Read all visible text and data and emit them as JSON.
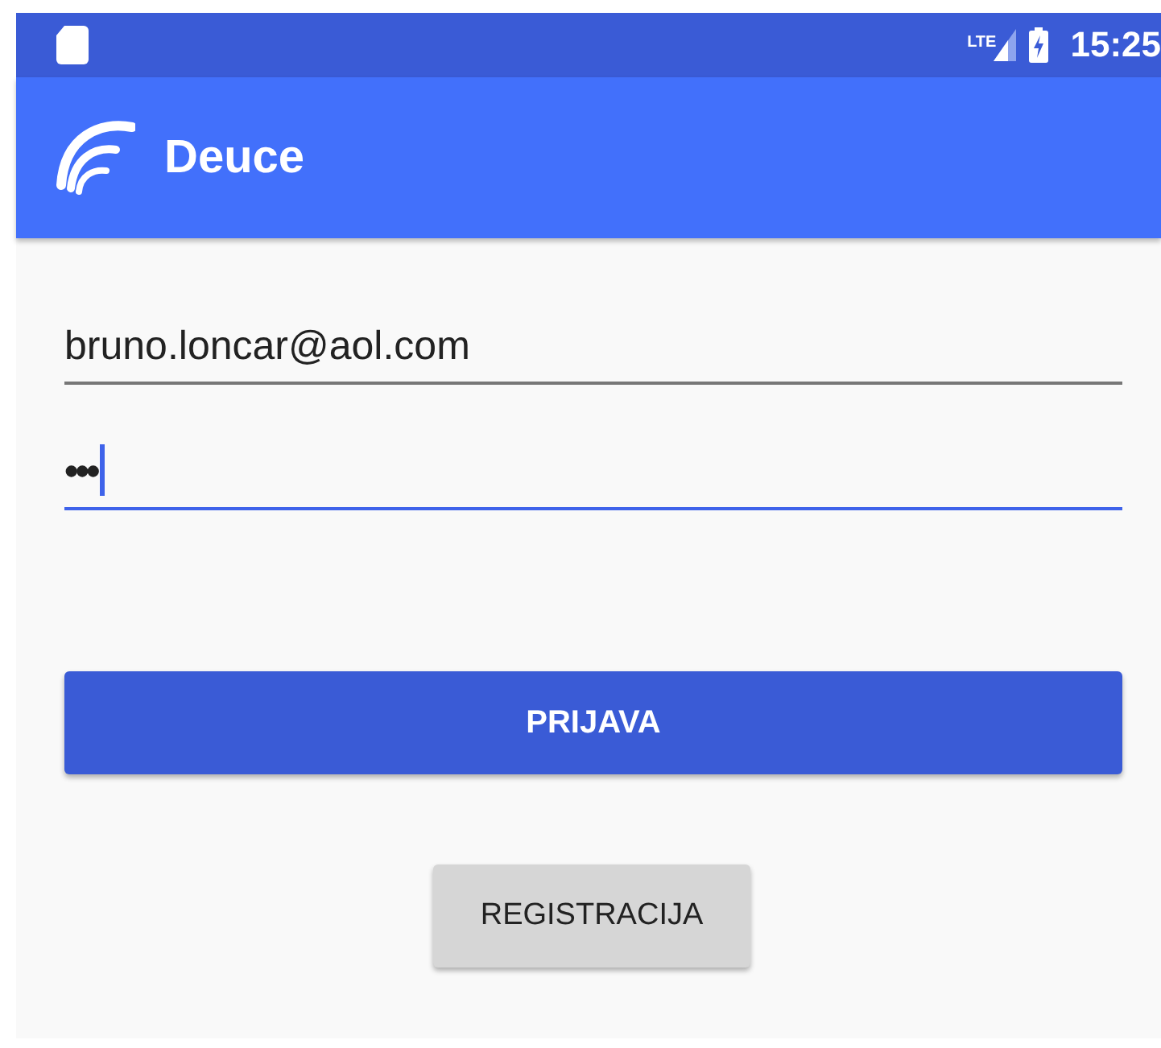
{
  "status_bar": {
    "network": "LTE",
    "time": "15:25"
  },
  "app_bar": {
    "title": "Deuce"
  },
  "fields": [
    {
      "kind": "email",
      "value": "bruno.loncar@aol.com",
      "focused": false
    },
    {
      "kind": "password",
      "value": "•••",
      "focused": true
    }
  ],
  "buttons": [
    {
      "kind": "primary",
      "label": "PRIJAVA"
    },
    {
      "kind": "secondary",
      "label": "REGISTRACIJA"
    }
  ]
}
